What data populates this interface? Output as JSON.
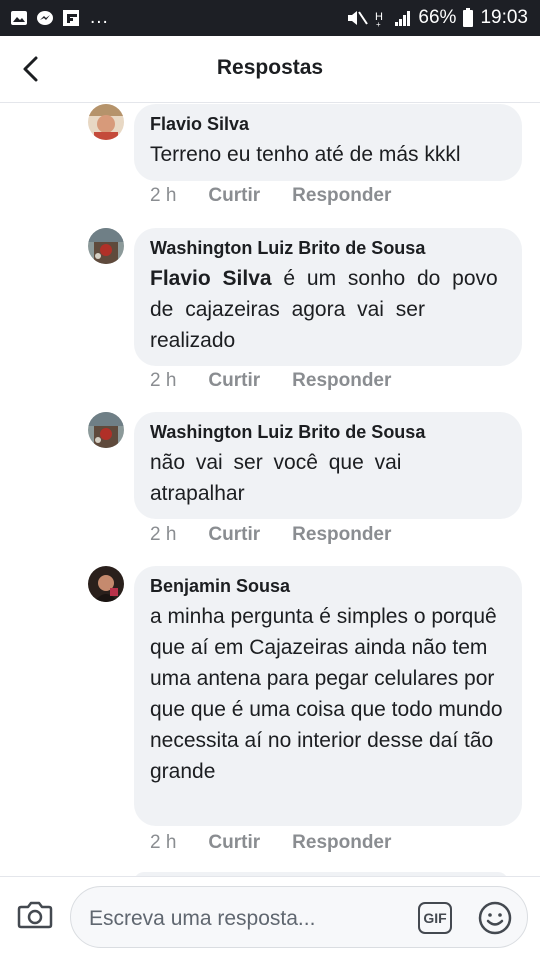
{
  "status_bar": {
    "dots": "...",
    "battery": "66%",
    "time": "19:03"
  },
  "header": {
    "title": "Respostas"
  },
  "comments": [
    {
      "author": "Flavio Silva",
      "text": "Terreno eu tenho até de más kkkl",
      "time": "2 h",
      "like": "Curtir",
      "reply": "Responder"
    },
    {
      "author": "Washington Luiz Brito de Sousa",
      "mention": "Flavio Silva",
      "text_after_mention": " é um sonho do povo de cajazeiras agora vai ser realizado",
      "time": "2 h",
      "like": "Curtir",
      "reply": "Responder"
    },
    {
      "author": "Washington Luiz Brito de Sousa",
      "text": "não vai ser você que vai atrapalhar",
      "time": "2 h",
      "like": "Curtir",
      "reply": "Responder"
    },
    {
      "author": "Benjamin Sousa",
      "text": "a minha pergunta é simples o porquê que aí em Cajazeiras ainda não tem uma antena para pegar celulares por que que é uma coisa que todo mundo necessita aí no interior desse daí tão grande",
      "time": "2 h",
      "like": "Curtir",
      "reply": "Responder"
    }
  ],
  "composer": {
    "placeholder": "Escreva uma resposta...",
    "gif_label": "GIF"
  },
  "icons": {
    "back": "back-arrow-icon",
    "camera": "camera-icon",
    "emoji": "emoji-icon"
  }
}
